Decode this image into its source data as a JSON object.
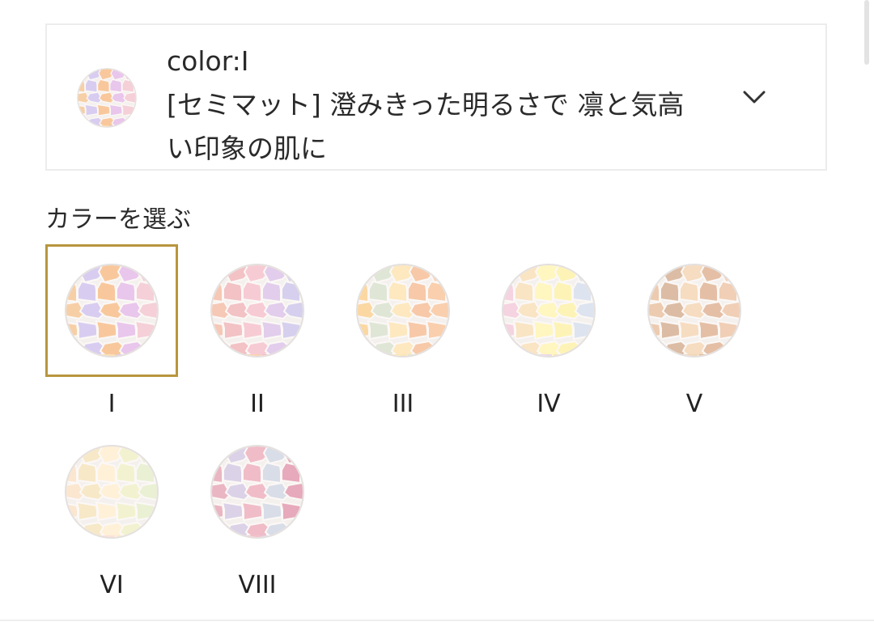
{
  "selector": {
    "color_label": "color:I",
    "description": "[セミマット] 澄みきった明るさで 凛と気高い印象の肌に",
    "chevron_icon": "chevron-down-icon"
  },
  "section_title": "カラーを選ぶ",
  "swatches": [
    {
      "label": "I",
      "selected": true,
      "colors": [
        "#f7cfa6",
        "#e9c6ec",
        "#fbe0b4",
        "#d8cdf0",
        "#f5d0d8",
        "#dfe6d2",
        "#f8c89c",
        "#e6d2f4"
      ]
    },
    {
      "label": "II",
      "selected": false,
      "colors": [
        "#f6c8b6",
        "#e2cdec",
        "#f9d2b0",
        "#f2c2c4",
        "#d6d0ee",
        "#fbdcc0",
        "#f7cbd4",
        "#eac9b8"
      ]
    },
    {
      "label": "III",
      "selected": false,
      "colors": [
        "#fbd7a2",
        "#f7c9a8",
        "#fde5b4",
        "#dfe6d6",
        "#f9cfae",
        "#f3d0b6",
        "#fde8c0",
        "#e8e2d0"
      ]
    },
    {
      "label": "IV",
      "selected": false,
      "colors": [
        "#f5d3e0",
        "#fdf3b6",
        "#e8d8ec",
        "#f9e4c4",
        "#dde4ef",
        "#fbd6cc",
        "#fff6c0",
        "#ecdae8"
      ]
    },
    {
      "label": "V",
      "selected": false,
      "colors": [
        "#eccbb0",
        "#e4bfa6",
        "#f2d6b8",
        "#dcbca4",
        "#f0cfb6",
        "#e8c4ae",
        "#f6dcc0",
        "#e2c2aa"
      ]
    },
    {
      "label": "VI",
      "selected": false,
      "colors": [
        "#fbe6d0",
        "#f3f2d0",
        "#fde0d8",
        "#f7e8c8",
        "#eaf0d4",
        "#fbd8d0",
        "#fff0d8",
        "#f5e2da"
      ]
    },
    {
      "label": "VIII",
      "selected": false,
      "colors": [
        "#eab6c4",
        "#d8dde8",
        "#f2c3cc",
        "#dbd2e8",
        "#e7a9bc",
        "#e8e0e4",
        "#f0bcc8",
        "#cfd8e2"
      ]
    }
  ],
  "thumb_colors": [
    "#f7cfa6",
    "#e9c6ec",
    "#fbe0b4",
    "#d8cdf0",
    "#f5d0d8",
    "#dfe6d2",
    "#f8c89c",
    "#e6d2f4"
  ]
}
